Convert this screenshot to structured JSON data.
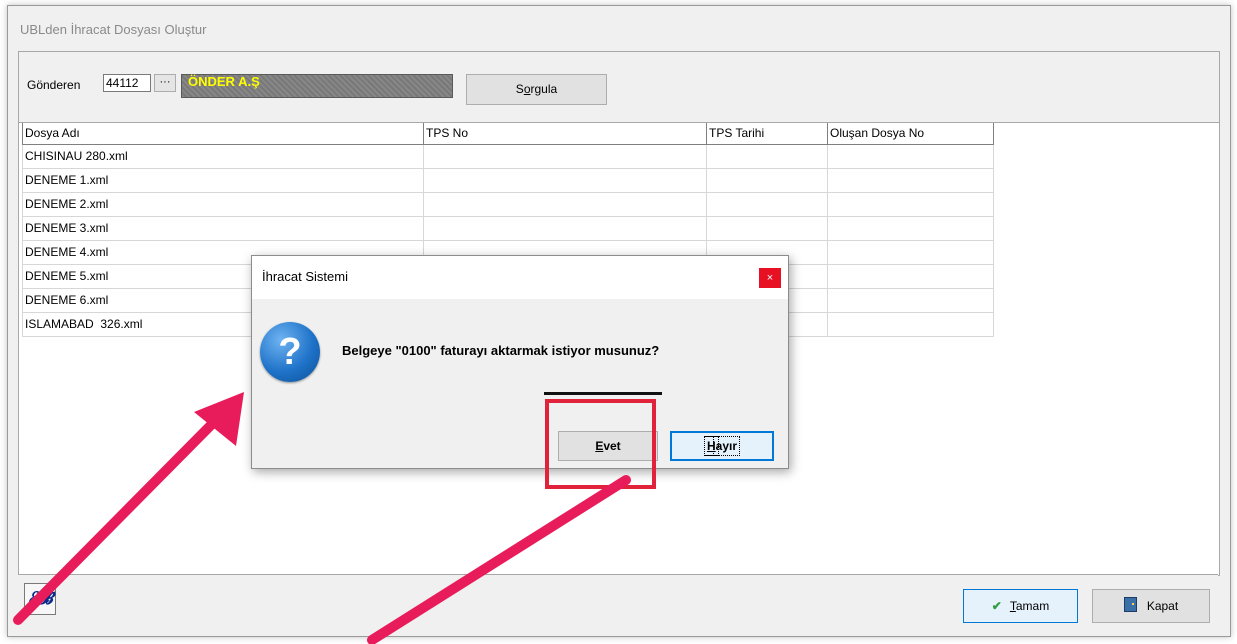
{
  "window": {
    "title": "UBLden İhracat Dosyası Oluştur"
  },
  "filter": {
    "sender_label": "Gönderen",
    "sender_code": "44112",
    "lookup_glyph": "···",
    "sender_name": "ÖNDER A.Ş",
    "query_button_pre": "S",
    "query_button_ul": "o",
    "query_button_post": "rgula"
  },
  "grid": {
    "columns": [
      "Dosya Adı",
      "TPS No",
      "TPS Tarihi",
      "Oluşan Dosya No"
    ],
    "rows": [
      [
        "CHISINAU 280.xml",
        "",
        "",
        ""
      ],
      [
        "DENEME 1.xml",
        "",
        "",
        ""
      ],
      [
        "DENEME 2.xml",
        "",
        "",
        ""
      ],
      [
        "DENEME 3.xml",
        "",
        "",
        ""
      ],
      [
        "DENEME 4.xml",
        "",
        "",
        ""
      ],
      [
        "DENEME 5.xml",
        "",
        "",
        ""
      ],
      [
        "DENEME 6.xml",
        "",
        "",
        ""
      ],
      [
        "ISLAMABAD  326.xml",
        "",
        "",
        ""
      ]
    ]
  },
  "footer": {
    "eb_logo": "ℰ𝓑",
    "ok_ul": "T",
    "ok_rest": "amam",
    "close_label": "Kapat"
  },
  "dialog": {
    "title": "İhracat Sistemi",
    "close_glyph": "×",
    "icon_glyph": "?",
    "message": "Belgeye \"0100\" faturayı aktarmak istiyor musunuz?",
    "yes_ul": "E",
    "yes_rest": "vet",
    "no_ul": "H",
    "no_rest": "ayır"
  },
  "colors": {
    "annotation": "#e81c5a",
    "highlight": "#e0233a",
    "sender_name_text": "#ffff00"
  },
  "icons": [
    "question-icon",
    "check-icon",
    "door-exit-icon",
    "eb-logo-icon",
    "close-icon",
    "annotation-arrow"
  ]
}
